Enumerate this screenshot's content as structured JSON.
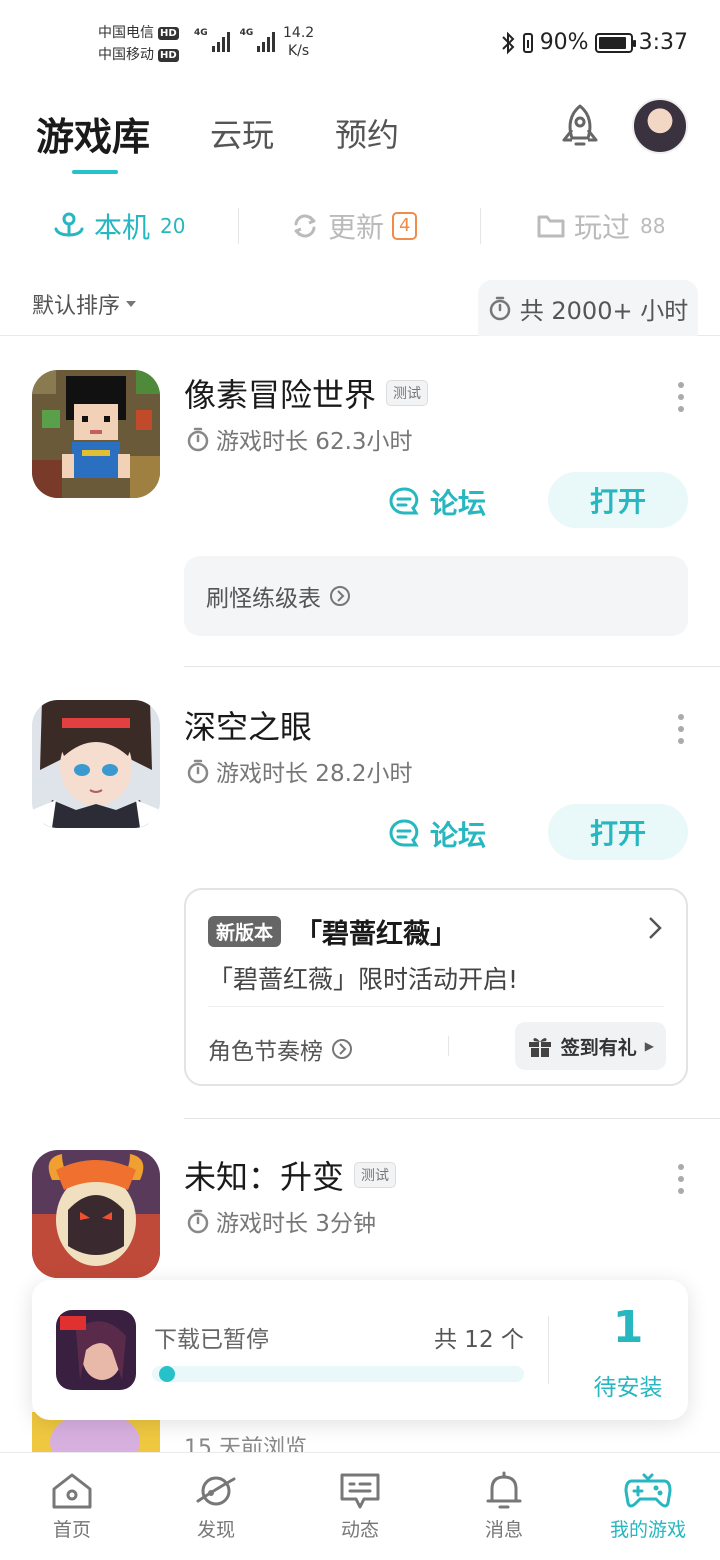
{
  "status_bar": {
    "carrier1": "中国电信",
    "carrier2": "中国移动",
    "hd": "HD",
    "net_tag": "4G",
    "speed_value": "14.2",
    "speed_unit": "K/s",
    "battery_pct": "90%",
    "battery_level": 0.9,
    "time": "3:37"
  },
  "top_tabs": {
    "main": "游戏库",
    "tab2": "云玩",
    "tab3": "预约"
  },
  "sub_tabs": [
    {
      "label": "本机",
      "count": "20"
    },
    {
      "label": "更新",
      "count": "4"
    },
    {
      "label": "玩过",
      "count": "88"
    }
  ],
  "sort": {
    "label": "默认排序",
    "total_hours": "共 2000+ 小时"
  },
  "games": [
    {
      "title": "像素冒险世界",
      "tag": "测试",
      "play_time": "游戏时长 62.3小时",
      "forum_label": "论坛",
      "open_label": "打开",
      "guide": "刷怪练级表"
    },
    {
      "title": "深空之眼",
      "play_time": "游戏时长 28.2小时",
      "forum_label": "论坛",
      "open_label": "打开",
      "news": {
        "tag": "新版本",
        "title": "「碧蔷红薇」",
        "desc": "「碧蔷红薇」限时活动开启!",
        "footer_link": "角色节奏榜",
        "signin": "签到有礼"
      }
    },
    {
      "title": "未知：升变",
      "tag": "测试",
      "play_time": "游戏时长 3分钟"
    }
  ],
  "download": {
    "status": "下载已暂停",
    "total": "共 12 个",
    "count": "1",
    "pending": "待安装",
    "progress": 0.02
  },
  "browsed": "15 天前浏览",
  "bottom_nav": [
    {
      "label": "首页"
    },
    {
      "label": "发现"
    },
    {
      "label": "动态"
    },
    {
      "label": "消息"
    },
    {
      "label": "我的游戏"
    }
  ],
  "colors": {
    "accent": "#27b7c0",
    "badge": "#f08c4a"
  }
}
